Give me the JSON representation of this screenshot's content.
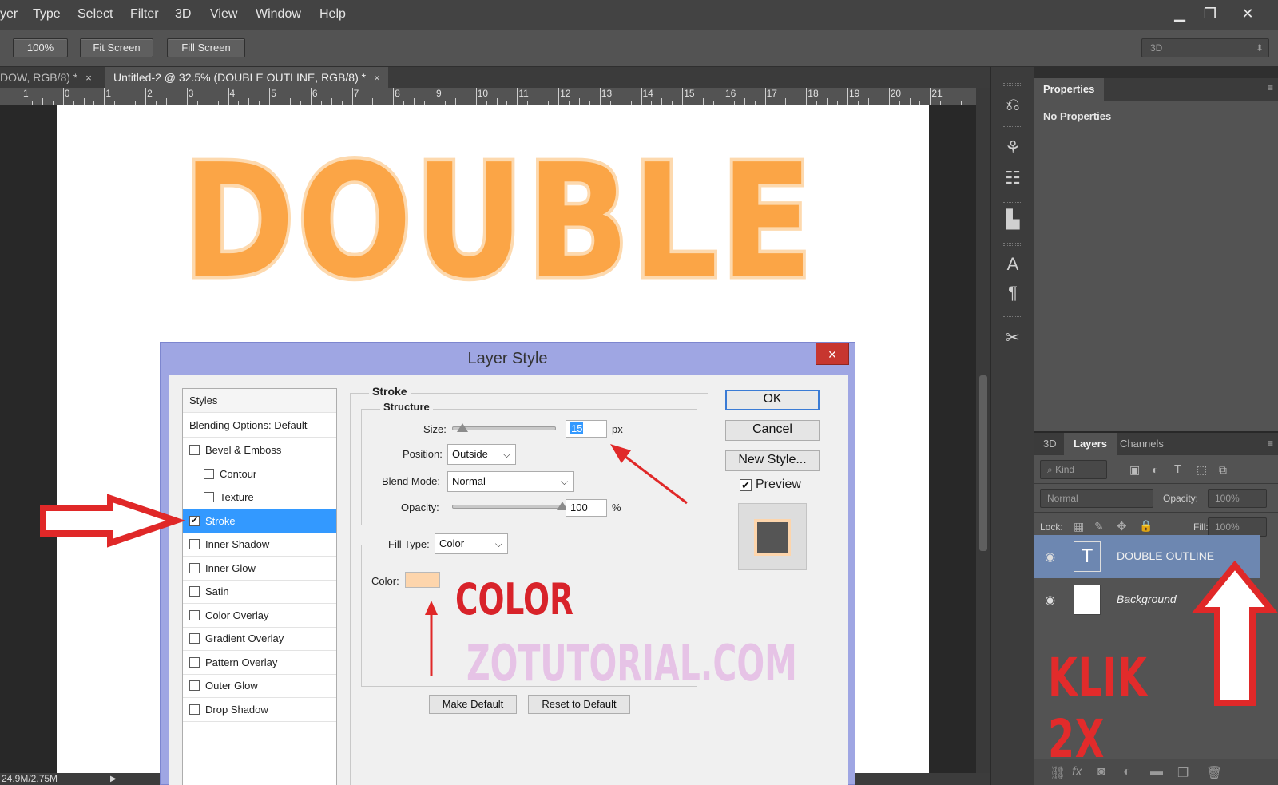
{
  "menu": [
    "yer",
    "Type",
    "Select",
    "Filter",
    "3D",
    "View",
    "Window",
    "Help"
  ],
  "window_controls": {
    "minimize": "▁",
    "restore": "❐",
    "close": "✕"
  },
  "options_bar": {
    "zoom_100": "100%",
    "fit_screen": "Fit Screen",
    "fill_screen": "Fill Screen",
    "workspace": "3D"
  },
  "tabs": [
    {
      "label": "DOW, RGB/8) *",
      "close": "×"
    },
    {
      "label": "Untitled-2 @ 32.5% (DOUBLE OUTLINE, RGB/8) *",
      "close": "×"
    }
  ],
  "ruler": {
    "labels": [
      "1",
      "0",
      "1",
      "2",
      "3",
      "4",
      "5",
      "6",
      "7",
      "8",
      "9",
      "10",
      "11",
      "12",
      "13",
      "14",
      "15",
      "16",
      "17",
      "18",
      "19",
      "20",
      "21"
    ]
  },
  "canvas": {
    "text": "DOUBLE",
    "fill_color": "#fba546",
    "stroke_color": "#fdd9ae"
  },
  "status": {
    "doc_size": "24.9M/2.75M"
  },
  "properties_panel": {
    "tab": "Properties",
    "message": "No Properties"
  },
  "layers_panel": {
    "tabs": [
      "3D",
      "Layers",
      "Channels"
    ],
    "filter_kind": "Kind",
    "blend_mode": "Normal",
    "opacity_label": "Opacity:",
    "opacity_value": "100%",
    "lock_label": "Lock:",
    "fill_label": "Fill:",
    "fill_value": "100%",
    "layers": [
      {
        "name": "DOUBLE OUTLINE",
        "selected": true,
        "thumb": "T"
      },
      {
        "name": "Background",
        "selected": false,
        "thumb": ""
      }
    ],
    "annotation": "KLIK 2X"
  },
  "dialog": {
    "title": "Layer Style",
    "close": "×",
    "styles_header": "Styles",
    "blending_options": "Blending Options: Default",
    "style_items": [
      {
        "label": "Bevel & Emboss",
        "checked": false,
        "indent": false
      },
      {
        "label": "Contour",
        "checked": false,
        "indent": true
      },
      {
        "label": "Texture",
        "checked": false,
        "indent": true
      },
      {
        "label": "Stroke",
        "checked": true,
        "indent": false,
        "selected": true
      },
      {
        "label": "Inner Shadow",
        "checked": false,
        "indent": false
      },
      {
        "label": "Inner Glow",
        "checked": false,
        "indent": false
      },
      {
        "label": "Satin",
        "checked": false,
        "indent": false
      },
      {
        "label": "Color Overlay",
        "checked": false,
        "indent": false
      },
      {
        "label": "Gradient Overlay",
        "checked": false,
        "indent": false
      },
      {
        "label": "Pattern Overlay",
        "checked": false,
        "indent": false
      },
      {
        "label": "Outer Glow",
        "checked": false,
        "indent": false
      },
      {
        "label": "Drop Shadow",
        "checked": false,
        "indent": false
      }
    ],
    "stroke": {
      "section_title": "Stroke",
      "structure_title": "Structure",
      "size_label": "Size:",
      "size_value": "15",
      "size_unit": "px",
      "size_slider": 0.1,
      "position_label": "Position:",
      "position_value": "Outside",
      "blend_label": "Blend Mode:",
      "blend_value": "Normal",
      "opacity_label": "Opacity:",
      "opacity_value": "100",
      "opacity_unit": "%",
      "opacity_slider": 1.0,
      "fill_type_label": "Fill Type:",
      "fill_type_value": "Color",
      "color_label": "Color:",
      "color_value": "#fdd5ac"
    },
    "buttons": {
      "ok": "OK",
      "cancel": "Cancel",
      "new_style": "New Style...",
      "make_default": "Make Default",
      "reset_default": "Reset to Default"
    },
    "preview_label": "Preview",
    "preview_checked": true,
    "annotation_color": "COLOR",
    "watermark": "ZOTUTORIAL.COM"
  }
}
